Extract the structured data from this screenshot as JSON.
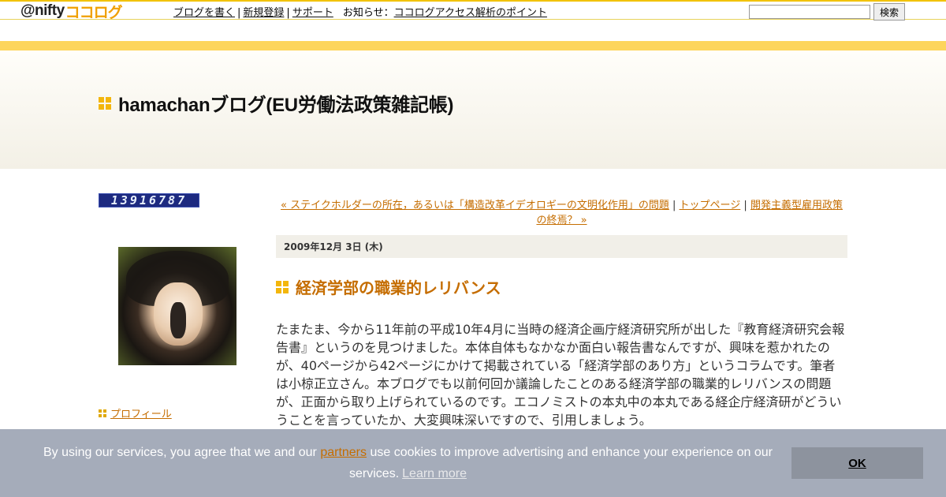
{
  "topbar": {
    "logo_prefix": "@nifty",
    "logo_brand": "ココログ",
    "nav": {
      "write_blog": "ブログを書く",
      "register": "新規登録",
      "support": "サポート",
      "notice_label": "お知らせ",
      "notice_colon": "：",
      "notice_link": "ココログアクセス解析のポイント"
    },
    "search_input_value": "",
    "search_button": "検索"
  },
  "banner": {
    "title": "hamachanブログ(EU労働法政策雑記帳)"
  },
  "sidebar": {
    "counter": "13916787",
    "profile_link": "プロフィール"
  },
  "main": {
    "prev_link": "« ステイクホルダーの所在，あるいは「構造改革イデオロギーの文明化作用」の問題",
    "sep1": " | ",
    "top_link": "トップページ",
    "sep2": " | ",
    "next_link": "開発主義型雇用政策の終焉？ »",
    "date": "2009年12月 3日 (木)",
    "entry_title": "経済学部の職業的レリバンス",
    "body": "たまたま、今から11年前の平成10年4月に当時の経済企画庁経済研究所が出した『教育経済研究会報告書』というのを見つけました。本体自体もなかなか面白い報告書なんですが、興味を惹かれたのが、40ページから42ページにかけて掲載されている「経済学部のあり方」というコラムです。筆者は小椋正立さん。本ブログでも以前何回か議論したことのある経済学部の職業的レリバンスの問題が、正面から取り上げられているのです。エコノミストの本丸中の本丸である経企庁経済研がどういうことを言っていたか、大変興味深いですので、引用しましょう。"
  },
  "cookie": {
    "text_before": "By using our services, you agree that we and our ",
    "partners_link": "partners",
    "text_after": " use cookies to improve advertising and enhance your experience on our services.",
    "learn_more": "Learn more",
    "ok_button": "OK"
  },
  "colors": {
    "accent_orange": "#c56d00",
    "bullet_yellow": "#f3b60c",
    "strip_yellow": "#fdd55c",
    "cookie_bg": "#a0a8b6"
  }
}
